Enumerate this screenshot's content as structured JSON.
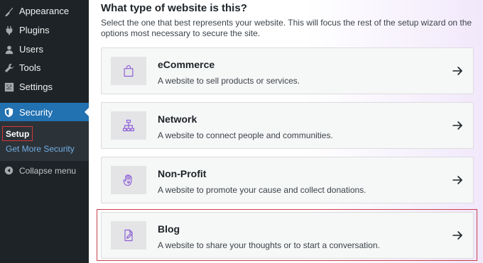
{
  "sidebar": {
    "items": [
      {
        "label": "Appearance",
        "icon": "appearance-icon"
      },
      {
        "label": "Plugins",
        "icon": "plugins-icon"
      },
      {
        "label": "Users",
        "icon": "users-icon"
      },
      {
        "label": "Tools",
        "icon": "tools-icon"
      },
      {
        "label": "Settings",
        "icon": "settings-icon"
      }
    ],
    "active": {
      "label": "Security",
      "icon": "shield-icon"
    },
    "submenu": {
      "setup": "Setup",
      "more": "Get More Security"
    },
    "collapse": "Collapse menu"
  },
  "main": {
    "heading": "What type of website is this?",
    "description": "Select the one that best represents your website. This will focus the rest of the setup wizard on the options most necessary to secure the site.",
    "options": [
      {
        "title": "eCommerce",
        "subtitle": "A website to sell products or services.",
        "icon": "shopping-bag-icon"
      },
      {
        "title": "Network",
        "subtitle": "A website to connect people and communities.",
        "icon": "network-icon"
      },
      {
        "title": "Non-Profit",
        "subtitle": "A website to promote your cause and collect donations.",
        "icon": "hand-heart-icon"
      },
      {
        "title": "Blog",
        "subtitle": "A website to share your thoughts or to start a conversation.",
        "icon": "edit-document-icon"
      }
    ]
  },
  "colors": {
    "sidebar_bg": "#1d2327",
    "active_bg": "#2271b1",
    "link": "#72aee6",
    "highlight_border": "#c9404c",
    "icon_accent": "#8c5fd6"
  }
}
